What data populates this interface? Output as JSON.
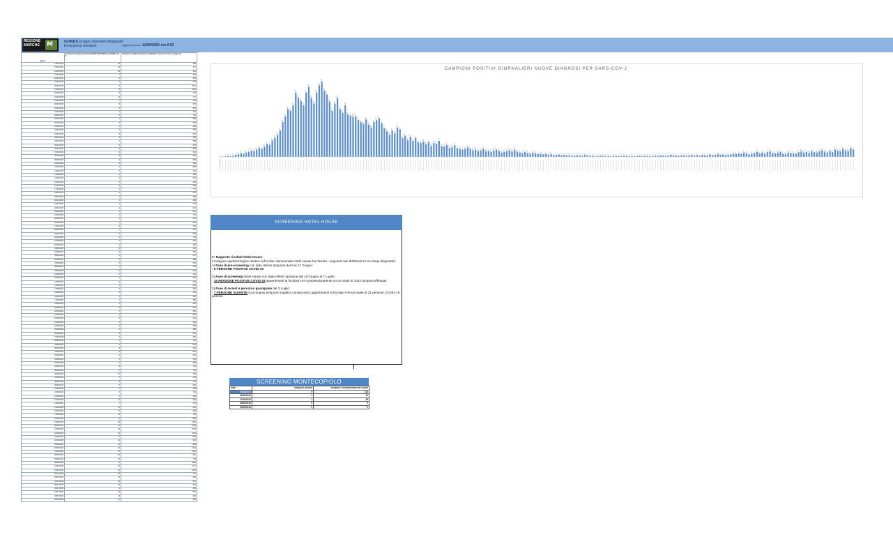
{
  "header": {
    "logo_text": [
      "REGIONE",
      "MARCHE"
    ],
    "org_short": "GORES",
    "org_line1": "Gruppo Operativo Regionale",
    "org_line2": "Emergenze Sanitarie",
    "update_label": "aggiornamento:",
    "update_value": "12/09/2020 ore 9.00"
  },
  "table": {
    "col_date": "giorno",
    "col_positive": "Campioni Positivi giornalieri NUOVE DIAGNOSI per SARS-Cov-2",
    "col_tested": "Campioni complessivamente testati(primo percorso nuove diagnosi)",
    "rows": [
      [
        "14/03/2020",
        "34",
        "289"
      ],
      [
        "15/03/2020",
        "45",
        "372"
      ],
      [
        "16/03/2020",
        "29",
        "363"
      ],
      [
        "17/03/2020",
        "7",
        "511"
      ],
      [
        "18/03/2020",
        "6",
        "666"
      ],
      [
        "19/03/2020",
        "5",
        "630"
      ],
      [
        "20/03/2020",
        "6",
        "1012"
      ],
      [
        "21/03/2020",
        "8",
        "1052"
      ],
      [
        "22/03/2020",
        "5",
        "779"
      ],
      [
        "23/03/2020",
        "11",
        "717"
      ],
      [
        "24/03/2020",
        "7",
        "730"
      ],
      [
        "25/03/2020",
        "8",
        "576"
      ],
      [
        "26/03/2020",
        "6",
        "893"
      ],
      [
        "27/03/2020",
        "7",
        "741"
      ],
      [
        "28/03/2020",
        "6",
        "700"
      ],
      [
        "29/03/2020",
        "4",
        "588"
      ],
      [
        "30/03/2020",
        "5",
        "676"
      ],
      [
        "31/03/2020",
        "6",
        "521"
      ],
      [
        "01/04/2020",
        "4",
        "566"
      ],
      [
        "02/04/2020",
        "3",
        "512"
      ],
      [
        "03/04/2020",
        "4",
        "611"
      ],
      [
        "04/04/2020",
        "3",
        "568"
      ],
      [
        "05/04/2020",
        "5",
        "578"
      ],
      [
        "06/04/2020",
        "4",
        "501"
      ],
      [
        "07/04/2020",
        "3",
        "614"
      ],
      [
        "08/04/2020",
        "3",
        "560"
      ],
      [
        "09/04/2020",
        "2",
        "608"
      ],
      [
        "10/04/2020",
        "3",
        "402"
      ],
      [
        "11/04/2020",
        "2",
        "658"
      ],
      [
        "12/04/2020",
        "2",
        "534"
      ],
      [
        "13/04/2020",
        "2",
        "385"
      ],
      [
        "14/04/2020",
        "1",
        "592"
      ],
      [
        "15/04/2020",
        "2",
        "609"
      ],
      [
        "16/04/2020",
        "1",
        "653"
      ],
      [
        "17/04/2020",
        "1",
        "777"
      ],
      [
        "18/04/2020",
        "2",
        "623"
      ],
      [
        "19/04/2020",
        "1",
        "539"
      ],
      [
        "20/04/2020",
        "2",
        "698"
      ],
      [
        "21/04/2020",
        "1",
        "713"
      ],
      [
        "22/04/2020",
        "1",
        "617"
      ],
      [
        "23/04/2020",
        "1",
        "687"
      ],
      [
        "24/04/2020",
        "1",
        "707"
      ],
      [
        "25/04/2020",
        "1",
        "574"
      ],
      [
        "26/04/2020",
        "1",
        "526"
      ],
      [
        "27/04/2020",
        "0",
        "606"
      ],
      [
        "28/04/2020",
        "1",
        "572"
      ],
      [
        "29/04/2020",
        "0",
        "653"
      ],
      [
        "30/04/2020",
        "1",
        "733"
      ],
      [
        "01/05/2020",
        "0",
        "546"
      ],
      [
        "02/05/2020",
        "1",
        "484"
      ],
      [
        "03/05/2020",
        "0",
        "371"
      ],
      [
        "04/05/2020",
        "0",
        "582"
      ],
      [
        "05/05/2020",
        "1",
        "587"
      ],
      [
        "06/05/2020",
        "0",
        "588"
      ],
      [
        "07/05/2020",
        "0",
        "553"
      ],
      [
        "08/05/2020",
        "1",
        "653"
      ],
      [
        "09/05/2020",
        "0",
        "663"
      ],
      [
        "10/05/2020",
        "1",
        "481"
      ],
      [
        "11/05/2020",
        "0",
        "551"
      ],
      [
        "12/05/2020",
        "0",
        "601"
      ],
      [
        "13/05/2020",
        "1",
        "624"
      ],
      [
        "14/05/2020",
        "0",
        "624"
      ],
      [
        "15/05/2020",
        "0",
        "653"
      ],
      [
        "16/05/2020",
        "0",
        "497"
      ],
      [
        "17/05/2020",
        "1",
        "485"
      ],
      [
        "18/05/2020",
        "0",
        "656"
      ],
      [
        "19/05/2020",
        "0",
        "621"
      ],
      [
        "20/05/2020",
        "0",
        "646"
      ],
      [
        "21/05/2020",
        "1",
        "612"
      ],
      [
        "22/05/2020",
        "0",
        "641"
      ],
      [
        "23/05/2020",
        "0",
        "556"
      ],
      [
        "24/05/2020",
        "0",
        "528"
      ],
      [
        "25/05/2020",
        "0",
        "489"
      ],
      [
        "26/05/2020",
        "0",
        "567"
      ],
      [
        "27/05/2020",
        "1",
        "600"
      ],
      [
        "28/05/2020",
        "2",
        "732"
      ],
      [
        "29/05/2020",
        "4",
        "554"
      ],
      [
        "30/05/2020",
        "5",
        "636"
      ],
      [
        "31/05/2020",
        "3",
        "587"
      ],
      [
        "01/06/2020",
        "2",
        "501"
      ],
      [
        "02/06/2020",
        "1",
        "563"
      ],
      [
        "03/06/2020",
        "2",
        "681"
      ],
      [
        "04/06/2020",
        "3",
        "741"
      ],
      [
        "05/06/2020",
        "2",
        "718"
      ],
      [
        "06/06/2020",
        "10",
        "603"
      ],
      [
        "07/06/2020",
        "7",
        "714"
      ],
      [
        "08/06/2020",
        "8",
        "773"
      ],
      [
        "09/06/2020",
        "5",
        "684"
      ],
      [
        "10/06/2020",
        "2",
        "760"
      ],
      [
        "11/06/2020",
        "4",
        "713"
      ],
      [
        "12/06/2020",
        "6",
        "685"
      ],
      [
        "13/06/2020",
        "11",
        "603"
      ],
      [
        "14/06/2020",
        "7",
        "597"
      ],
      [
        "15/06/2020",
        "12",
        "661"
      ],
      [
        "16/06/2020",
        "9",
        "528"
      ],
      [
        "17/06/2020",
        "10",
        "708"
      ],
      [
        "18/06/2020",
        "6",
        "963"
      ],
      [
        "19/06/2020",
        "13",
        "1050"
      ],
      [
        "20/06/2020",
        "11",
        "1043"
      ],
      [
        "21/06/2020",
        "14",
        "1074"
      ],
      [
        "22/06/2020",
        "14",
        "1143"
      ],
      [
        "23/06/2020",
        "9",
        "825"
      ],
      [
        "24/06/2020",
        "13",
        "951"
      ],
      [
        "25/06/2020",
        "11",
        "886"
      ],
      [
        "26/06/2020",
        "14",
        "1016"
      ],
      [
        "27/06/2020",
        "12",
        "1011"
      ],
      [
        "28/06/2020",
        "15",
        "937"
      ],
      [
        "29/06/2020",
        "13",
        "798"
      ],
      [
        "30/06/2020",
        "6",
        "1008"
      ],
      [
        "31/06/2020",
        "16",
        "1171"
      ],
      [
        "01/07/2020",
        "12",
        "1052"
      ],
      [
        "02/07/2020",
        "10",
        "717"
      ],
      [
        "03/07/2020",
        "13",
        "925"
      ],
      [
        "04/07/2020",
        "15",
        "867"
      ],
      [
        "05/07/2020",
        "10",
        "920"
      ],
      [
        "06/07/2020",
        "9",
        "922"
      ],
      [
        "07/07/2020",
        "13",
        "937"
      ],
      [
        "08/07/2020",
        "14",
        "935"
      ],
      [
        "09/07/2020",
        "21",
        "823"
      ]
    ]
  },
  "chart_data": {
    "type": "bar",
    "title": "CAMPIONI POSITIVI GIORNALIERI NUOVE DIAGNOSI PER SARS-COV-2",
    "xlabel": "",
    "ylabel": "",
    "start_label": "24/02/2020",
    "values": [
      1,
      1,
      2,
      3,
      2,
      4,
      6,
      8,
      10,
      9,
      12,
      14,
      17,
      16,
      20,
      25,
      22,
      28,
      35,
      33,
      45,
      52,
      60,
      72,
      95,
      110,
      130,
      125,
      140,
      175,
      160,
      152,
      140,
      175,
      190,
      160,
      145,
      175,
      195,
      205,
      180,
      170,
      150,
      125,
      145,
      160,
      130,
      120,
      140,
      115,
      112,
      108,
      110,
      100,
      95,
      90,
      102,
      88,
      80,
      95,
      100,
      105,
      92,
      78,
      70,
      60,
      72,
      64,
      80,
      75,
      52,
      58,
      45,
      55,
      44,
      52,
      40,
      38,
      42,
      35,
      40,
      30,
      38,
      36,
      44,
      30,
      28,
      33,
      25,
      27,
      32,
      24,
      22,
      20,
      22,
      26,
      22,
      18,
      20,
      16,
      18,
      22,
      15,
      17,
      14,
      18,
      20,
      16,
      12,
      14,
      16,
      18,
      15,
      20,
      14,
      12,
      10,
      13,
      11,
      9,
      12,
      10,
      8,
      9,
      7,
      9,
      6,
      8,
      5,
      6,
      7,
      5,
      6,
      4,
      5,
      3,
      4,
      5,
      4,
      3,
      6,
      4,
      3,
      4,
      2,
      3,
      4,
      3,
      2,
      3,
      2,
      4,
      3,
      2,
      3,
      4,
      3,
      2,
      3,
      2,
      3,
      4,
      2,
      3,
      3,
      2,
      3,
      4,
      3,
      5,
      4,
      3,
      4,
      6,
      5,
      4,
      3,
      5,
      4,
      3,
      5,
      6,
      4,
      5,
      3,
      6,
      5,
      4,
      7,
      5,
      6,
      8,
      6,
      7,
      5,
      6,
      7,
      9,
      8,
      10,
      8,
      12,
      10,
      7,
      9,
      11,
      14,
      10,
      12,
      9,
      13,
      15,
      11,
      10,
      12,
      14,
      9,
      8,
      12,
      11,
      10,
      9,
      13,
      15,
      12,
      14,
      11,
      16,
      13,
      12,
      15,
      18,
      14,
      12,
      16,
      13,
      20,
      17,
      15,
      22,
      18,
      16,
      24,
      20
    ],
    "ylim": [
      0,
      220
    ]
  },
  "hotel_house": {
    "title": "SCREENING HOTEL HOUSE",
    "p1_bold": "1° Rapporto  risultati Hotel House",
    "p1_text": ":",
    "p1_line2": "L'indagine epidemiologica relativa al focolaio denominato Hotel House ha rilevato i seguenti casi distribuiti su tre tempi diagnostici:",
    "f1_prefix": "1) ",
    "f1_bold": "Fase di pre-screening",
    "f1_text": " con data referto tampone dal 9 al 17 Giugno:",
    "f1_result": "- 6 PERSONE POSITIVE COVID-19",
    "f2_prefix": "2) ",
    "f2_bold": "Fase di screening",
    "f2_text": " Hotel House con data referto tampone dal 18 Giugno al 7 Luglio:",
    "f2_dash": "- ",
    "f2_result": "15 PERSONE POSITIVE COVID-19",
    "f2_rest": " appartenenti al focolaio HH complessivamente su un totale di 1024 tamponi effettuati",
    "f3_prefix": "3) ",
    "f3_bold": "Fase di re-test e percorso guarigione",
    "f3_text": " dal 3 Luglio:",
    "f3_dash": "- ",
    "f3_result": "7 PERSONE GUARITE",
    "f3_rest": " (con doppio tampone negativo consecutivo) appartenenti al focolaio HH sul totale di 21 persone COVID-19 positive"
  },
  "montecopiolo": {
    "title": "SCREENING MONTECOPIOLO",
    "col_date": "data",
    "col_pos": "campioni positivi",
    "col_tot": "campioni complessivamente testati",
    "rows": [
      [
        "05/08/2020",
        "3",
        "216"
      ],
      [
        "06/08/2020",
        "1",
        "13"
      ],
      [
        "07/08/2020",
        "1",
        "98"
      ],
      [
        "08/08/2020",
        "0",
        "5"
      ],
      [
        "09/08/2020",
        "0",
        "0"
      ]
    ]
  }
}
